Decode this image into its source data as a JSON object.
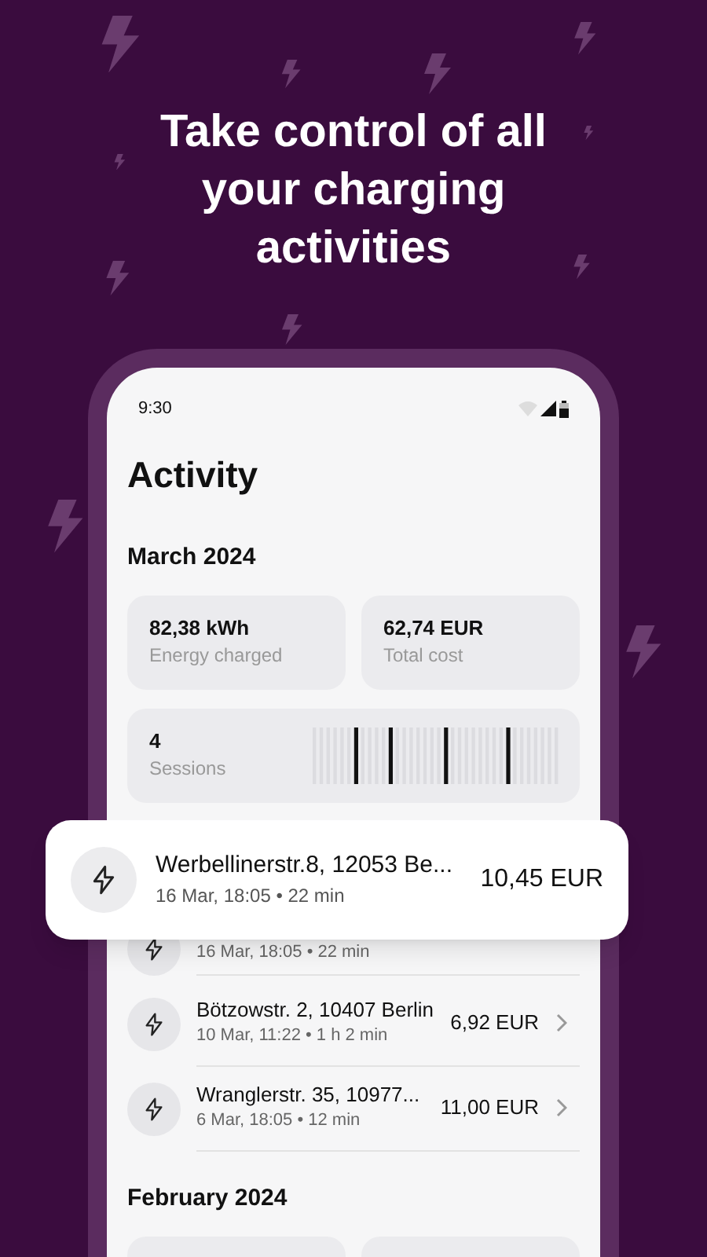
{
  "headline": "Take control of all your charging activities",
  "status_bar": {
    "time": "9:30"
  },
  "screen_title": "Activity",
  "months": [
    {
      "title": "March 2024",
      "stats": [
        {
          "kind": "stat",
          "value": "82,38 kWh",
          "label": "Energy charged"
        },
        {
          "kind": "stat",
          "value": "62,74 EUR",
          "label": "Total cost"
        }
      ],
      "sessions": {
        "value": "4",
        "label": "Sessions"
      },
      "charges": [
        {
          "subtitle": "16 Mar, 18:05 • 22 min"
        },
        {
          "title": "Bötzowstr. 2, 10407 Berlin",
          "subtitle": "10 Mar, 11:22 • 1 h 2 min",
          "price": "6,92 EUR"
        },
        {
          "title": "Wranglerstr. 35, 10977...",
          "subtitle": "6 Mar, 18:05 • 12 min",
          "price": "11,00 EUR"
        }
      ]
    },
    {
      "title": "February 2024",
      "stats": [
        {
          "kind": "empty"
        },
        {
          "kind": "empty"
        }
      ]
    }
  ],
  "highlight": {
    "title": "Werbellinerstr.8, 12053 Be...",
    "subtitle": "16 Mar, 18:05 • 22 min",
    "price": "10,45 EUR"
  }
}
